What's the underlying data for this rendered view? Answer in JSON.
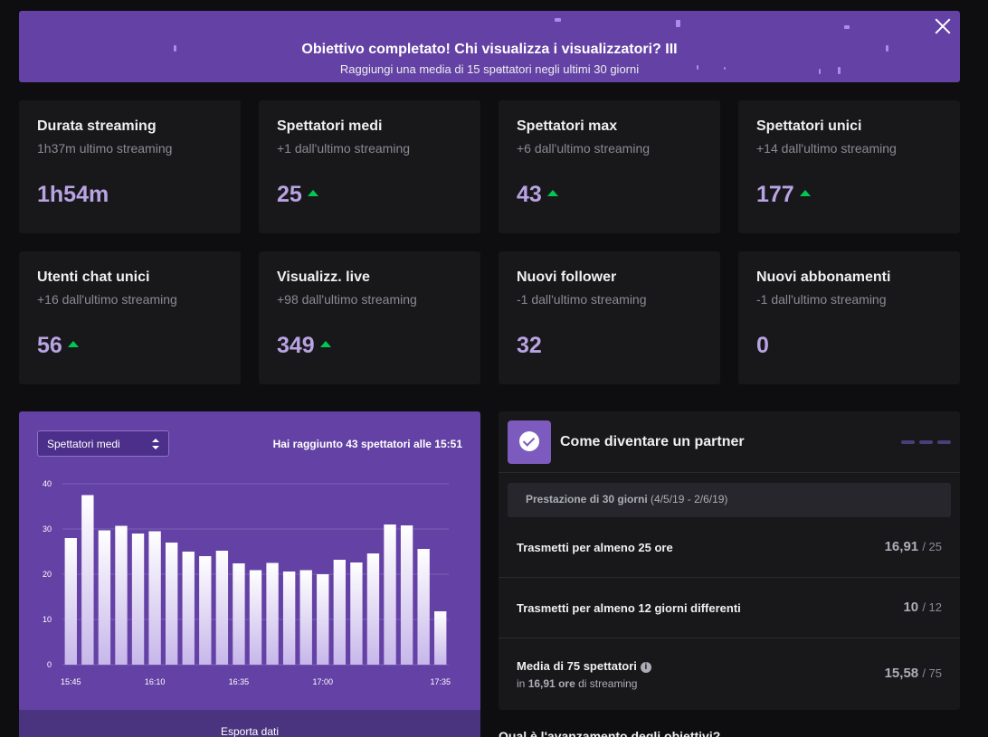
{
  "banner": {
    "title": "Obiettivo completato! Chi visualizza i visualizzatori? III",
    "subtitle": "Raggiungi una media di 15 spettatori negli ultimi 30 giorni"
  },
  "stats": [
    {
      "title": "Durata streaming",
      "sub": "1h37m ultimo streaming",
      "value": "1h54m",
      "up": false
    },
    {
      "title": "Spettatori medi",
      "sub": "+1 dall'ultimo streaming",
      "value": "25",
      "up": true
    },
    {
      "title": "Spettatori max",
      "sub": "+6 dall'ultimo streaming",
      "value": "43",
      "up": true
    },
    {
      "title": "Spettatori unici",
      "sub": "+14 dall'ultimo streaming",
      "value": "177",
      "up": true
    },
    {
      "title": "Utenti chat unici",
      "sub": "+16 dall'ultimo streaming",
      "value": "56",
      "up": true
    },
    {
      "title": "Visualizz. live",
      "sub": "+98 dall'ultimo streaming",
      "value": "349",
      "up": true
    },
    {
      "title": "Nuovi follower",
      "sub": "-1 dall'ultimo streaming",
      "value": "32",
      "up": false
    },
    {
      "title": "Nuovi abbonamenti",
      "sub": "-1 dall'ultimo streaming",
      "value": "0",
      "up": false
    }
  ],
  "chart": {
    "select_value": "Spettatori medi",
    "note": "Hai raggiunto 43 spettatori alle 15:51",
    "export_label": "Esporta dati"
  },
  "chart_data": {
    "type": "bar",
    "values": [
      28,
      37.5,
      29.7,
      30.7,
      29,
      29.5,
      27,
      25,
      24,
      25.2,
      22.4,
      20.9,
      22.5,
      20.6,
      20.9,
      20,
      23.2,
      22.6,
      24.6,
      31,
      30.8,
      25.6,
      11.8
    ],
    "x_tick_labels": [
      "15:45",
      "16:10",
      "16:35",
      "17:00",
      "17:35"
    ],
    "y_ticks": [
      0,
      10,
      20,
      30,
      40
    ],
    "ylim": [
      0,
      40
    ],
    "grid": true,
    "colors": {
      "bar_top": "#ffffff",
      "bar_bottom": "#c7b7ea",
      "grid": "#7d61b8",
      "axis_text": "#ffffff"
    }
  },
  "partner": {
    "title": "Come diventare un partner",
    "period_label": "Prestazione di 30 giorni",
    "period_dates": "(4/5/19 - 2/6/19)",
    "requirements": [
      {
        "label": "Trasmetti per almeno 25 ore",
        "value": "16,91",
        "total": "/ 25"
      },
      {
        "label": "Trasmetti per almeno 12 giorni differenti",
        "value": "10",
        "total": "/ 12"
      },
      {
        "label": "Media di 75 spettatori",
        "value": "15,58",
        "total": "/ 75",
        "sub_prefix": "in",
        "sub_bold": "16,91",
        "sub_middle": "ore",
        "sub_suffix": "di streaming"
      }
    ]
  },
  "bottom_heading": "Qual è l'avanzamento degli obiettivi?"
}
